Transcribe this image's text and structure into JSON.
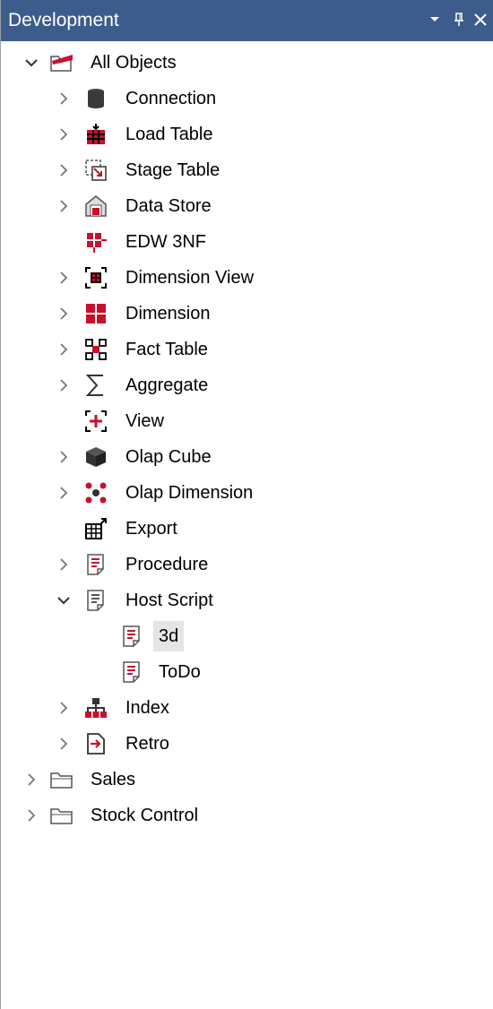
{
  "panel": {
    "title": "Development",
    "buttons": {
      "dropdown_icon": "dropdown-arrow-icon",
      "pin_icon": "pin-icon",
      "close_icon": "close-icon"
    },
    "colors": {
      "titlebar": "#3c5c8c",
      "icon_red": "#c8102e",
      "icon_dark": "#3a3a3a"
    }
  },
  "tree": {
    "root": {
      "label": "All Objects",
      "expanded": true
    },
    "children": [
      {
        "label": "Connection",
        "icon": "connection-icon",
        "expandable": true
      },
      {
        "label": "Load Table",
        "icon": "load-table-icon",
        "expandable": true
      },
      {
        "label": "Stage Table",
        "icon": "stage-table-icon",
        "expandable": true
      },
      {
        "label": "Data Store",
        "icon": "data-store-icon",
        "expandable": true
      },
      {
        "label": "EDW 3NF",
        "icon": "edw-3nf-icon",
        "expandable": false
      },
      {
        "label": "Dimension View",
        "icon": "dimension-view-icon",
        "expandable": true
      },
      {
        "label": "Dimension",
        "icon": "dimension-icon",
        "expandable": true
      },
      {
        "label": "Fact Table",
        "icon": "fact-table-icon",
        "expandable": true
      },
      {
        "label": "Aggregate",
        "icon": "aggregate-icon",
        "expandable": true
      },
      {
        "label": "View",
        "icon": "view-icon",
        "expandable": false
      },
      {
        "label": "Olap Cube",
        "icon": "olap-cube-icon",
        "expandable": true
      },
      {
        "label": "Olap Dimension",
        "icon": "olap-dimension-icon",
        "expandable": true
      },
      {
        "label": "Export",
        "icon": "export-icon",
        "expandable": false
      },
      {
        "label": "Procedure",
        "icon": "procedure-icon",
        "expandable": true
      },
      {
        "label": "Host Script",
        "icon": "host-script-icon",
        "expandable": true,
        "expanded": true
      },
      {
        "label": "Index",
        "icon": "index-icon",
        "expandable": true
      },
      {
        "label": "Retro",
        "icon": "retro-icon",
        "expandable": true
      }
    ],
    "host_script_children": [
      {
        "label": "3d",
        "icon": "script-icon",
        "selected": true
      },
      {
        "label": "ToDo",
        "icon": "script-icon",
        "selected": false
      }
    ],
    "other_folders": [
      {
        "label": "Sales",
        "icon": "folder-icon"
      },
      {
        "label": "Stock Control",
        "icon": "folder-icon"
      }
    ]
  }
}
